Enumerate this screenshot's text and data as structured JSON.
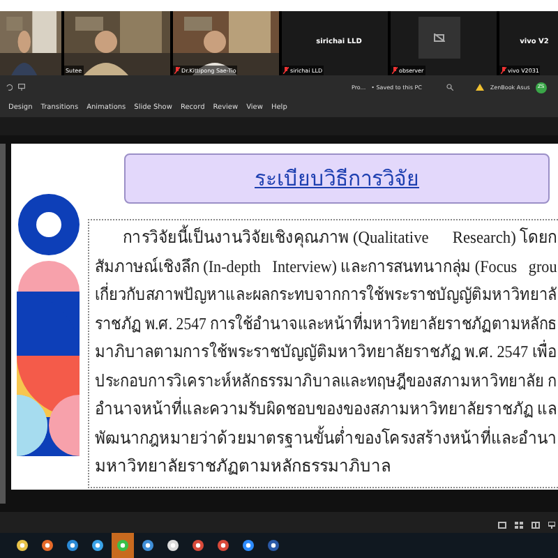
{
  "participants": [
    {
      "kind": "video"
    },
    {
      "kind": "video",
      "name": "Sutee",
      "muted": false
    },
    {
      "kind": "video",
      "name": "Dr.Kittipong Sae-Tio",
      "muted": true
    },
    {
      "kind": "name",
      "name": "sirichai LLD",
      "display": "sirichai LLD",
      "muted": true
    },
    {
      "kind": "camera_off",
      "name": "observer",
      "muted": true
    },
    {
      "kind": "name",
      "name": "vivo V2031",
      "display": "vivo V2",
      "muted": true
    }
  ],
  "title_bar": {
    "document": "Pro...",
    "saved": "• Saved to this PC",
    "account": "ZenBook Asus",
    "avatar": "ZS"
  },
  "ribbon_tabs": [
    "Design",
    "Transitions",
    "Animations",
    "Slide Show",
    "Record",
    "Review",
    "View",
    "Help"
  ],
  "slide": {
    "title": "ระเบียบวิธีการวิจัย",
    "lines": [
      "การวิจัยนี้เป็นงานวิจัยเชิงคุณภาพ (Qualitative      Research) โดยก",
      "สัมภาษณ์เชิงลึก (In-depth   Interview) และการสนทนากลุ่ม (Focus   grou",
      "เกี่ยวกับสภาพปัญหาและผลกระทบจากการใช้พระราชบัญญัติมหาวิทยาลั",
      "ราชภัฏ พ.ศ. 2547 การใช้อำนาจและหน้าที่มหาวิทยาลัยราชภัฏตามหลักธ",
      "มาภิบาลตามการใช้พระราชบัญญัติมหาวิทยาลัยราชภัฏ พ.ศ. 2547 เพื่อ",
      "ประกอบการวิเคราะห์หลักธรรมาภิบาลและทฤษฎีของสภามหาวิทยาลัย ก",
      "อำนาจหน้าที่และความรับผิดชอบของของสภามหาวิทยาลัยราชภัฏ แล",
      "พัฒนากฎหมายว่าด้วยมาตรฐานขั้นต่ำของโครงสร้างหน้าที่และอำนา",
      "มหาวิทยาลัยราชภัฏตามหลักธรรมาภิบาล"
    ]
  },
  "taskbar": [
    {
      "kind": "folder"
    },
    {
      "kind": "firefox"
    },
    {
      "kind": "edge"
    },
    {
      "kind": "ie"
    },
    {
      "kind": "chat",
      "selected": true
    },
    {
      "kind": "mail"
    },
    {
      "kind": "store"
    },
    {
      "kind": "chrome"
    },
    {
      "kind": "chrome"
    },
    {
      "kind": "zoom",
      "selected": false
    },
    {
      "kind": "word"
    }
  ]
}
